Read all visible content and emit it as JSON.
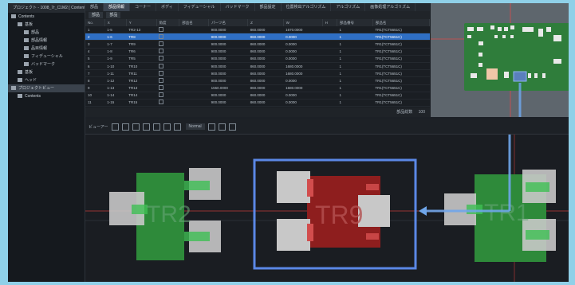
{
  "tree": {
    "header": "プロジェクト - 1008_7r_C1M2 [ Contents ]",
    "items": [
      {
        "label": "Contents",
        "level": 0,
        "icon": "folder-icon"
      },
      {
        "label": "基板",
        "level": 1,
        "icon": "folder-icon"
      },
      {
        "label": "部品",
        "level": 2,
        "icon": "part-icon"
      },
      {
        "label": "部品情報",
        "level": 2,
        "icon": "part-icon"
      },
      {
        "label": "品目情報",
        "level": 2,
        "icon": "part-icon"
      },
      {
        "label": "フィデューシャル",
        "level": 2,
        "icon": "part-icon"
      },
      {
        "label": "バッドマーク",
        "level": 2,
        "icon": "part-icon"
      },
      {
        "label": "基板",
        "level": 1,
        "icon": "board-icon"
      },
      {
        "label": "ヘッド",
        "level": 1,
        "icon": "head-icon"
      },
      {
        "label": "プロジェクトビュー",
        "level": 0,
        "icon": "view-icon",
        "selected": true
      },
      {
        "label": "Contents",
        "level": 1,
        "icon": "folder-icon"
      }
    ]
  },
  "table": {
    "tabs": [
      "部品",
      "部品情報",
      "コーナー",
      "ボディ",
      "フィデューシャル",
      "バッドマーク",
      "部品設定",
      "位置検出アルゴリズム",
      "アルゴリズム",
      "画像処理アルゴリズム"
    ],
    "active_tab": 1,
    "filter": [
      "部品",
      "部品"
    ],
    "columns": [
      "No.",
      "X",
      "Y",
      "角度",
      "部品名",
      "パーツ名",
      "Z",
      "W",
      "H",
      "部品番号",
      "部品名"
    ],
    "rows": [
      [
        "1",
        "1-5",
        "TR2-13",
        "",
        "",
        "900.0000",
        "860.0000",
        "1670.0000",
        "",
        "1",
        "TR1(TCT5651C)"
      ],
      [
        "2",
        "1-6",
        "TR8",
        "",
        "",
        "900.0000",
        "860.0000",
        "0.0000",
        "",
        "1",
        "TR1(TCT5651C)"
      ],
      [
        "3",
        "1-7",
        "TR9",
        "",
        "",
        "900.0000",
        "860.0000",
        "0.0000",
        "",
        "1",
        "TR1(TCT5651C)"
      ],
      [
        "4",
        "1-8",
        "TR6",
        "",
        "",
        "900.0000",
        "860.0000",
        "0.0000",
        "",
        "1",
        "TR1(TCT5651C)"
      ],
      [
        "5",
        "1-9",
        "TR5",
        "",
        "",
        "900.0000",
        "860.0000",
        "0.0000",
        "",
        "1",
        "TR1(TCT5651C)"
      ],
      [
        "6",
        "1-10",
        "TR10",
        "",
        "",
        "900.0000",
        "860.0000",
        "1680.0000",
        "",
        "1",
        "TR1(TCT5651C)"
      ],
      [
        "7",
        "1-11",
        "TR11",
        "",
        "",
        "900.0000",
        "860.0000",
        "1680.0000",
        "",
        "1",
        "TR1(TCT5651C)"
      ],
      [
        "8",
        "1-12",
        "TR12",
        "",
        "",
        "900.0000",
        "860.0000",
        "0.0000",
        "",
        "1",
        "TR1(TCT5651C)"
      ],
      [
        "9",
        "1-13",
        "TR13",
        "",
        "",
        "1550.0000",
        "860.0000",
        "1680.0000",
        "",
        "1",
        "TR1(TCT5651C)"
      ],
      [
        "10",
        "1-14",
        "TR14",
        "",
        "",
        "900.0000",
        "860.0000",
        "0.0000",
        "",
        "1",
        "TR1(TCT5651C)"
      ],
      [
        "11",
        "1-15",
        "TR15",
        "",
        "",
        "900.0000",
        "860.0000",
        "0.0000",
        "",
        "1",
        "TR1(TCT5651C)"
      ]
    ],
    "selected_row": 1,
    "status": [
      "部品総数",
      "100"
    ]
  },
  "viewer": {
    "toolbar_label": "ビューアー",
    "zoom_value": "Normal",
    "parts": [
      {
        "label": "TR2",
        "color": "#2e8a3a"
      },
      {
        "label": "TR9",
        "color": "#8e1e1e"
      },
      {
        "label": "TR1",
        "color": "#2e8a3a"
      }
    ]
  },
  "colors": {
    "highlight": "#5b88e6",
    "arrow": "#6fa6ea",
    "selection": "#2f6fc4",
    "crosshair": "#c23a3a"
  }
}
